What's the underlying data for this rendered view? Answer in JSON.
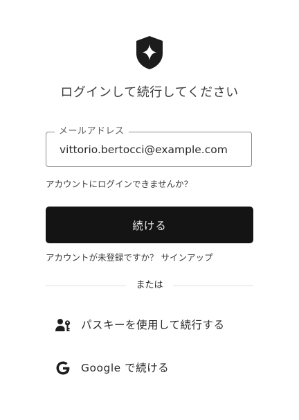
{
  "logo": {
    "icon": "shield-logo-icon"
  },
  "title": "ログインして続行してください",
  "email_field": {
    "label": "メールアドレス",
    "value": "vittorio.bertocci@example.com"
  },
  "cannot_login_link": "アカウントにログインできませんか？",
  "continue_button": "続ける",
  "signup_link": "アカウントが未登録ですか？ サインアップ",
  "divider_text": "または",
  "passkey_button": {
    "label": "パスキーを使用して続行する",
    "icon": "user-key-icon"
  },
  "google_button": {
    "label": "Google で続ける",
    "icon": "google-g-icon"
  },
  "colors": {
    "primary_button_bg": "#141414",
    "primary_button_text": "#e8e8e8",
    "border": "#8a8a8a",
    "text": "#2a2a2a"
  }
}
